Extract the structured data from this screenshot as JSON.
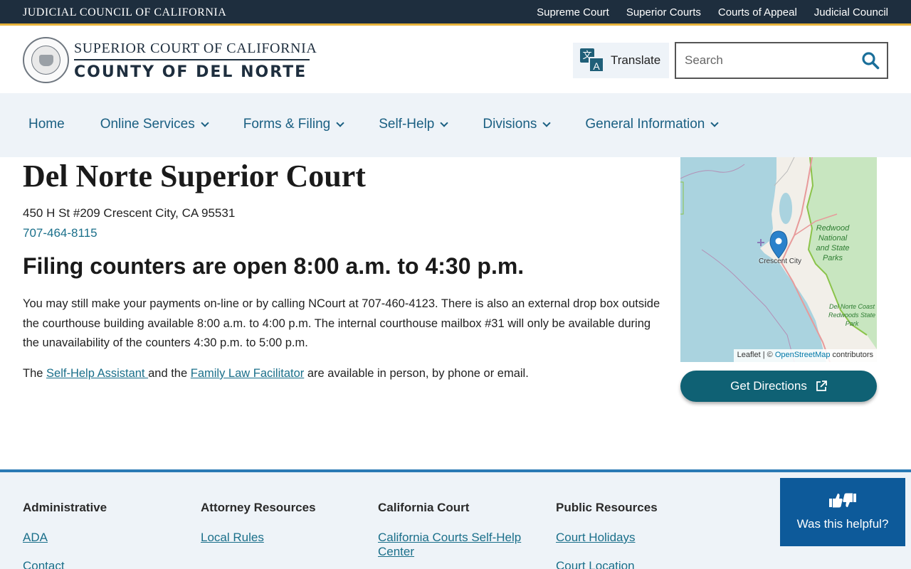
{
  "topbar": {
    "org": "JUDICIAL COUNCIL OF CALIFORNIA",
    "links": [
      "Supreme Court",
      "Superior Courts",
      "Courts of Appeal",
      "Judicial Council"
    ]
  },
  "header": {
    "brand_top": "SUPERIOR COURT OF CALIFORNIA",
    "brand_bottom": "COUNTY OF DEL NORTE",
    "translate_label": "Translate",
    "search_placeholder": "Search"
  },
  "nav": {
    "items": [
      {
        "label": "Home"
      },
      {
        "label": "Online Services"
      },
      {
        "label": "Forms & Filing"
      },
      {
        "label": "Self-Help"
      },
      {
        "label": "Divisions"
      },
      {
        "label": "General Information"
      }
    ]
  },
  "main": {
    "title": "Del Norte Superior Court",
    "address": "450 H St #209 Crescent City, CA 95531",
    "phone": "707-464-8115",
    "hours_heading": "Filing counters are open 8:00 a.m. to 4:30 p.m.",
    "para1": "You may still make your payments on-line or by calling NCourt at 707-460-4123.  There is also an external drop box outside the courthouse building available 8:00 a.m. to 4:00 p.m.  The internal courthouse mailbox #31 will only be available during the unavailability of the counters 4:30 p.m. to 5:00 p.m.",
    "para2_prefix": "The ",
    "self_help_link": "Self-Help Assistant ",
    "para2_mid": "and the ",
    "family_law_link": "Family Law Facilitator",
    "para2_suffix": " are available in person,  by phone or email."
  },
  "map": {
    "city_label": "Crescent City",
    "park1": "Redwood National and State Parks",
    "park2": "Del Norte Coast Redwoods State Park",
    "attr_leaflet": "Leaflet",
    "attr_sep": " | © ",
    "attr_osm": "OpenStreetMap",
    "attr_contrib": " contributors"
  },
  "directions_label": "Get Directions",
  "footer": {
    "columns": [
      {
        "heading": "Administrative",
        "links": [
          "ADA",
          "Contact"
        ]
      },
      {
        "heading": "Attorney Resources",
        "links": [
          "Local Rules"
        ]
      },
      {
        "heading": "California Court",
        "links": [
          "California Courts Self-Help Center"
        ]
      },
      {
        "heading": "Public Resources",
        "links": [
          "Court Holidays",
          "Court Location"
        ]
      }
    ]
  },
  "helpful_label": "Was this helpful?",
  "colors": {
    "topbar": "#1e2e3e",
    "accent_gold": "#e6b23a",
    "link": "#1a6f8a",
    "button": "#0f6174",
    "helpful": "#0d5a9a"
  }
}
